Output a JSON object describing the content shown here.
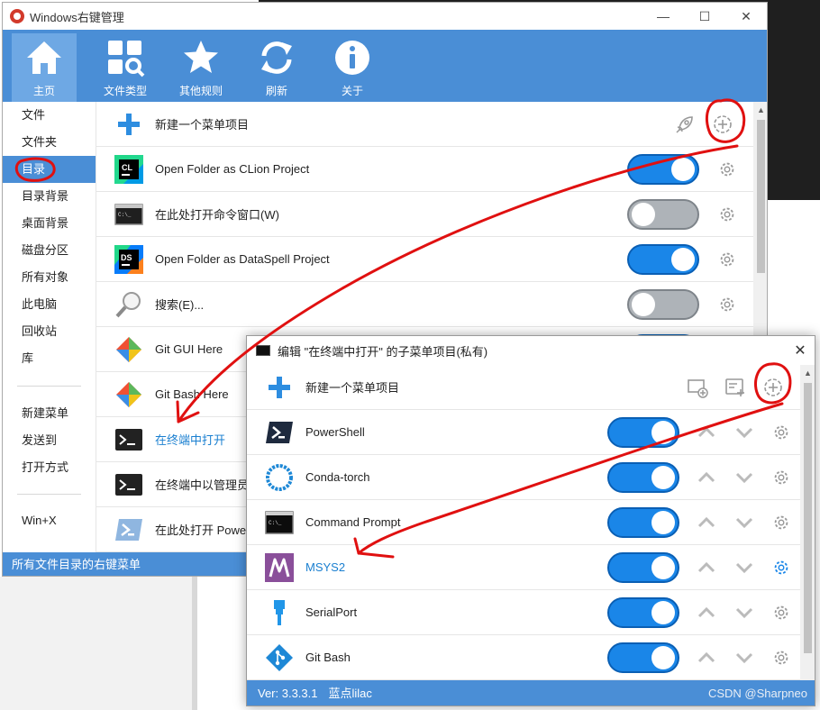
{
  "main": {
    "title": "Windows右键管理",
    "window_buttons": [
      "—",
      "☐",
      "✕"
    ],
    "toolbar": [
      {
        "label": "主页",
        "icon": "home-icon"
      },
      {
        "label": "文件类型",
        "icon": "file-types-icon"
      },
      {
        "label": "其他规则",
        "icon": "star-icon"
      },
      {
        "label": "刷新",
        "icon": "refresh-icon"
      },
      {
        "label": "关于",
        "icon": "info-icon"
      }
    ],
    "sidebar": [
      "文件",
      "文件夹",
      "目录",
      "目录背景",
      "桌面背景",
      "磁盘分区",
      "所有对象",
      "此电脑",
      "回收站",
      "库",
      "新建菜单",
      "发送到",
      "打开方式",
      "Win+X"
    ],
    "sidebar_active_index": 2,
    "rows": [
      {
        "label": "新建一个菜单项目",
        "icon": "add-icon"
      },
      {
        "label": "Open Folder as CLion Project",
        "icon": "clion-icon",
        "enabled": true
      },
      {
        "label": "在此处打开命令窗口(W)",
        "icon": "cmd-window-icon",
        "enabled": false
      },
      {
        "label": "Open Folder as DataSpell Project",
        "icon": "dataspell-icon",
        "enabled": true
      },
      {
        "label": "搜索(E)...",
        "icon": "search-icon",
        "enabled": false
      },
      {
        "label": "Git GUI Here",
        "icon": "git-gui-icon",
        "enabled": true
      },
      {
        "label": "Git Bash Here",
        "icon": "git-bash-icon",
        "enabled": true
      },
      {
        "label": "在终端中打开",
        "icon": "terminal-icon",
        "enabled": true
      },
      {
        "label": "在终端中以管理员身份打开",
        "icon": "terminal-admin-icon",
        "enabled": true
      },
      {
        "label": "在此处打开 PowerShell 窗口(S)",
        "icon": "powershell-icon",
        "enabled": true
      }
    ],
    "status": "所有文件目录的右键菜单"
  },
  "dialog": {
    "title": "编辑 \"在终端中打开\" 的子菜单项目(私有)",
    "close": "✕",
    "rows": [
      {
        "label": "新建一个菜单项目",
        "icon": "add-icon"
      },
      {
        "label": "PowerShell",
        "icon": "powershell-icon",
        "enabled": true
      },
      {
        "label": "Conda-torch",
        "icon": "conda-icon",
        "enabled": true
      },
      {
        "label": "Command Prompt",
        "icon": "cmd-prompt-icon",
        "enabled": true
      },
      {
        "label": "MSYS2",
        "icon": "msys2-icon",
        "enabled": true
      },
      {
        "label": "SerialPort",
        "icon": "serialport-icon",
        "enabled": true
      },
      {
        "label": "Git Bash",
        "icon": "git-bash-icon",
        "enabled": true
      }
    ],
    "status_version": "Ver: 3.3.3.1",
    "status_author": "蓝点lilac",
    "watermark": "CSDN @Sharpneo"
  },
  "colors": {
    "accent": "#4a8ed6",
    "toggle_on": "#1a86e8",
    "toggle_off": "#aeb3b8",
    "link": "#1a7fd0",
    "annotation": "#e01010"
  }
}
